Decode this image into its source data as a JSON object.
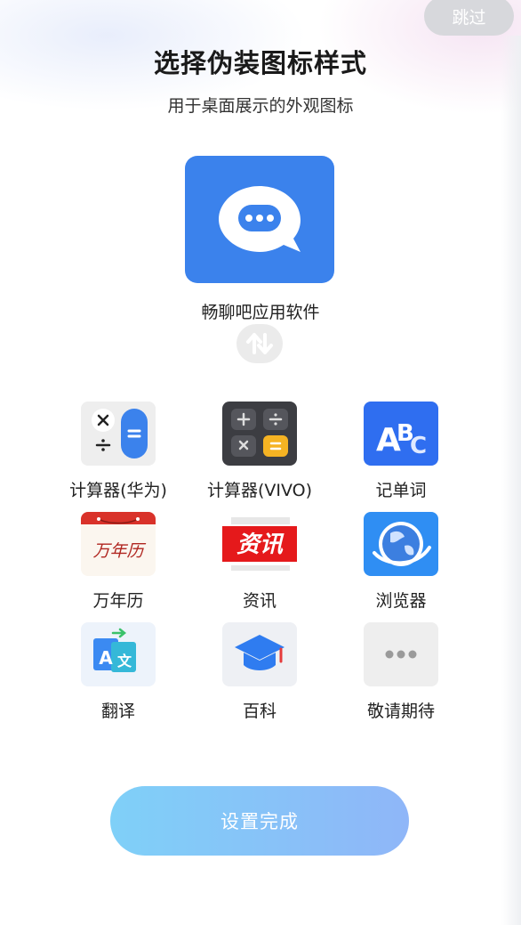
{
  "header": {
    "skip_label": "跳过",
    "title": "选择伪装图标样式",
    "subtitle": "用于桌面展示的外观图标"
  },
  "current": {
    "icon": "chat-bubble-icon",
    "label": "畅聊吧应用软件",
    "swap_icon": "swap-arrows-icon"
  },
  "options": [
    {
      "label": "计算器(华为)",
      "icon": "calculator-huawei-icon"
    },
    {
      "label": "计算器(VIVO)",
      "icon": "calculator-vivo-icon"
    },
    {
      "label": "记单词",
      "icon": "abc-words-icon"
    },
    {
      "label": "万年历",
      "icon": "calendar-icon",
      "icon_text": "万年历"
    },
    {
      "label": "资讯",
      "icon": "news-icon",
      "icon_text": "资讯"
    },
    {
      "label": "浏览器",
      "icon": "globe-icon"
    },
    {
      "label": "翻译",
      "icon": "translate-icon"
    },
    {
      "label": "百科",
      "icon": "graduation-cap-icon"
    },
    {
      "label": "敬请期待",
      "icon": "more-dots-icon"
    }
  ],
  "footer": {
    "done_label": "设置完成"
  },
  "colors": {
    "primary": "#3b82ec",
    "button_gradient_start": "#7fd0f8",
    "button_gradient_end": "#8fb6f8",
    "skip_bg": "#d7d8dc"
  }
}
